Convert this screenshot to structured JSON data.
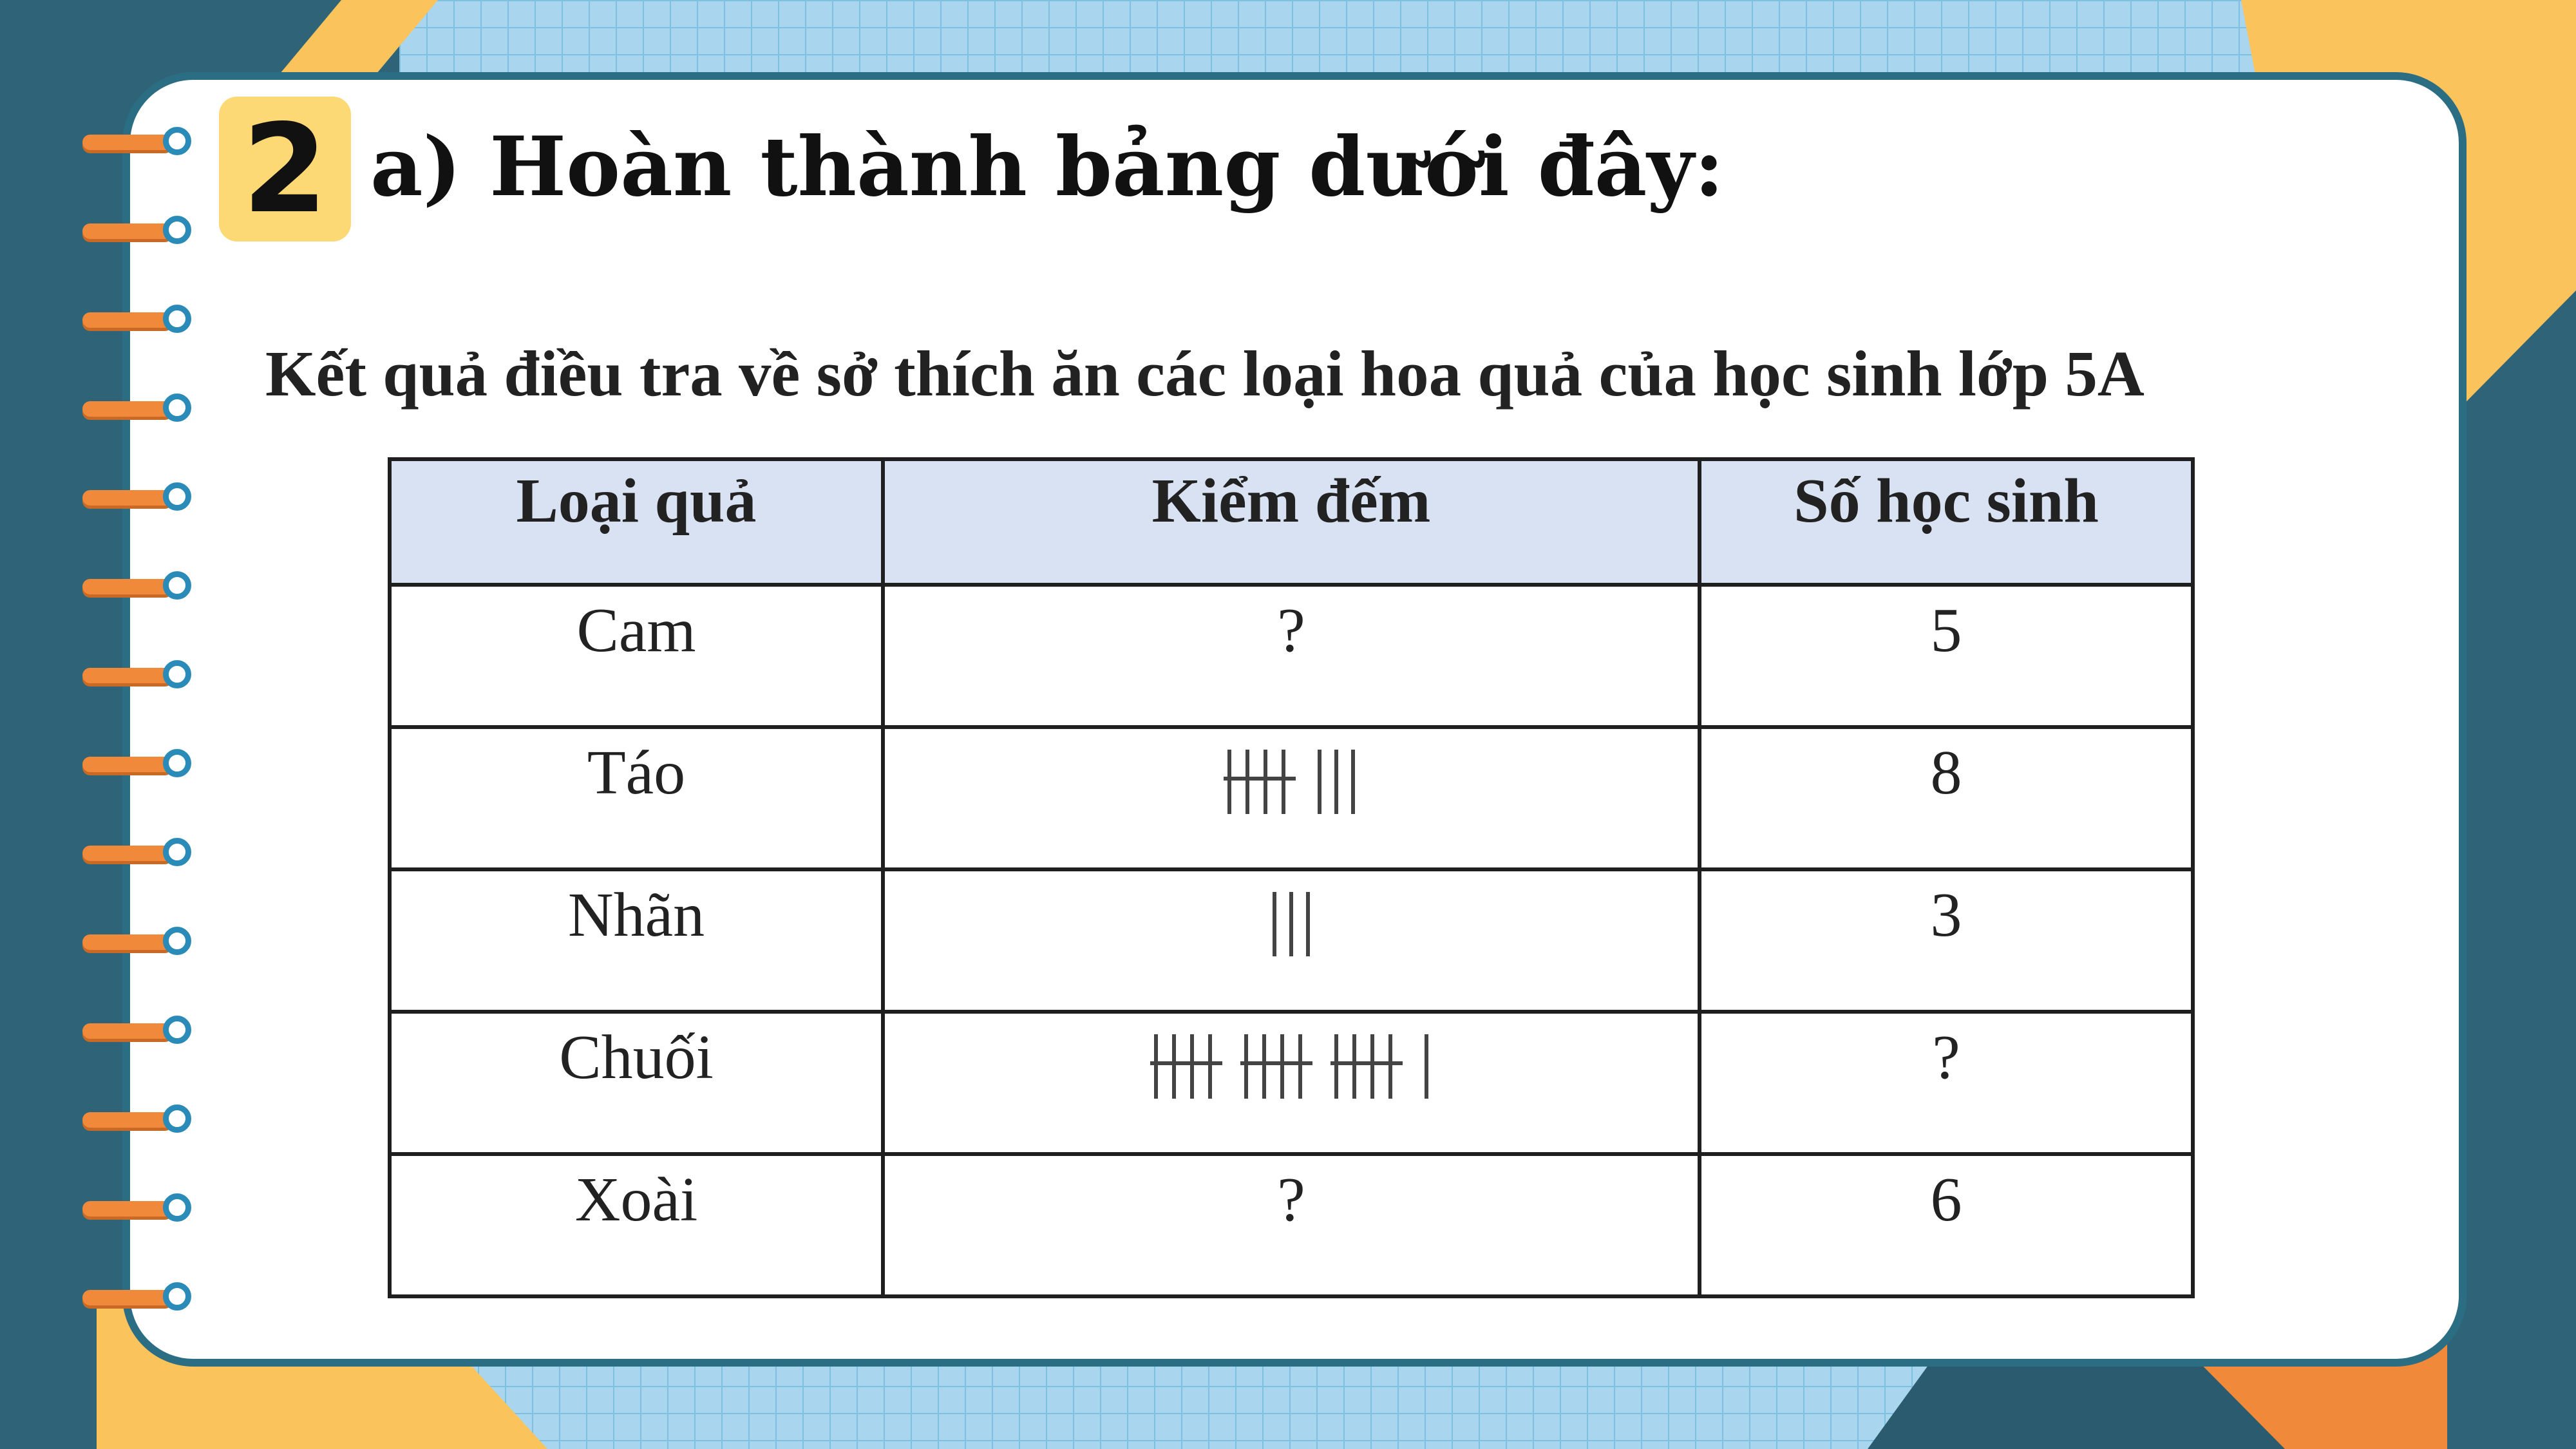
{
  "exercise": {
    "number": "2",
    "heading": "a) Hoàn thành bảng dưới đây:"
  },
  "caption": "Kết quả điều tra về sở thích ăn các loại hoa quả của học sinh lớp 5A",
  "table": {
    "headers": [
      "Loại quả",
      "Kiểm đếm",
      "Số học sinh"
    ],
    "rows": [
      {
        "fruit": "Cam",
        "tally": "?",
        "tally_count": null,
        "count": "5"
      },
      {
        "fruit": "Táo",
        "tally": "",
        "tally_count": 8,
        "count": "8"
      },
      {
        "fruit": "Nhãn",
        "tally": "",
        "tally_count": 3,
        "count": "3"
      },
      {
        "fruit": "Chuối",
        "tally": "",
        "tally_count": 16,
        "count": "?"
      },
      {
        "fruit": "Xoài",
        "tally": "?",
        "tally_count": null,
        "count": "6"
      }
    ]
  },
  "colors": {
    "badge": "#fcd974",
    "header_fill": "#d9e2f2",
    "card_border": "#2b6e84",
    "ring_orange": "#f08a3a",
    "ring_blue": "#2b8bb8"
  }
}
